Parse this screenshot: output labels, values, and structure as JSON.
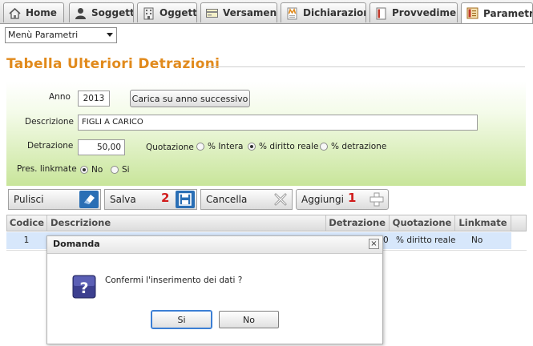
{
  "tabs": [
    {
      "label": "Home",
      "icon": "home-icon"
    },
    {
      "label": "Soggetti",
      "icon": "person-icon"
    },
    {
      "label": "Oggetti",
      "icon": "building-icon"
    },
    {
      "label": "Versamenti",
      "icon": "payment-icon"
    },
    {
      "label": "Dichiarazioni",
      "icon": "declaration-icon"
    },
    {
      "label": "Provvedimenti",
      "icon": "document-icon"
    },
    {
      "label": "Parametri",
      "icon": "parameters-icon",
      "active": true
    }
  ],
  "menu": {
    "selected": "Menù Parametri"
  },
  "section": {
    "title": "Tabella Ulteriori Detrazioni"
  },
  "form": {
    "anno_label": "Anno",
    "anno_value": "2013",
    "carica_button": "Carica su anno successivo",
    "descrizione_label": "Descrizione",
    "descrizione_value": "FIGLI A CARICO",
    "detrazione_label": "Detrazione",
    "detrazione_value": "50,00",
    "quotazione_label": "Quotazione",
    "quotazione_options": [
      "% Intera",
      "% diritto reale",
      "% detrazione"
    ],
    "quotazione_selected": 1,
    "linkmate_label": "Pres. linkmate",
    "linkmate_options": [
      "No",
      "Si"
    ],
    "linkmate_selected": 0
  },
  "toolbar": {
    "pulisci": "Pulisci",
    "salva": "Salva",
    "cancella": "Cancella",
    "aggiungi": "Aggiungi",
    "salva_badge": "2",
    "aggiungi_badge": "1"
  },
  "table": {
    "headers": [
      "Codice",
      "Descrizione",
      "Detrazione",
      "Quotazione",
      "Linkmate"
    ],
    "rows": [
      {
        "codice": "1",
        "detrazione_tail": "0",
        "quotazione": "% diritto reale",
        "linkmate": "No"
      }
    ]
  },
  "dialog": {
    "title": "Domanda",
    "close": "×",
    "message": "Confermi l'inserimento dei dati ?",
    "yes": "Si",
    "no": "No"
  },
  "colors": {
    "accent_title": "#e18a1c",
    "panel_green": "#c8e59a",
    "row_selected": "#d7e7fb",
    "badge_red": "#d11c1c"
  }
}
